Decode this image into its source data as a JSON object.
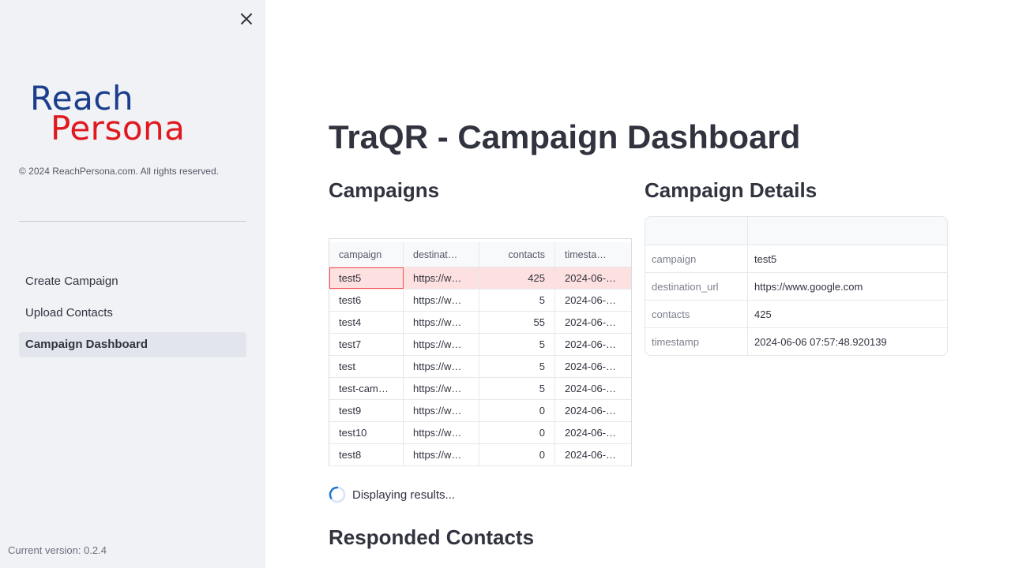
{
  "sidebar": {
    "logo": {
      "line1": "Reach",
      "line2": "Persona"
    },
    "copyright": "© 2024 ReachPersona.com. All rights reserved.",
    "nav": [
      {
        "label": "Create Campaign",
        "active": false
      },
      {
        "label": "Upload Contacts",
        "active": false
      },
      {
        "label": "Campaign Dashboard",
        "active": true
      }
    ],
    "version": "Current version: 0.2.4"
  },
  "main": {
    "title": "TraQR - Campaign Dashboard",
    "campaigns_heading": "Campaigns",
    "details_heading": "Campaign Details",
    "responded_heading": "Responded Contacts",
    "status_text": "Displaying results..."
  },
  "campaigns_table": {
    "columns": [
      "campaign",
      "destinat…",
      "contacts",
      "timesta…"
    ],
    "rows": [
      [
        "test5",
        "https://w…",
        "425",
        "2024-06-0…"
      ],
      [
        "test6",
        "https://w…",
        "5",
        "2024-06-0…"
      ],
      [
        "test4",
        "https://w…",
        "55",
        "2024-06-0…"
      ],
      [
        "test7",
        "https://w…",
        "5",
        "2024-06-0…"
      ],
      [
        "test",
        "https://w…",
        "5",
        "2024-06-0…"
      ],
      [
        "test-camp…",
        "https://w…",
        "5",
        "2024-06-0…"
      ],
      [
        "test9",
        "https://w…",
        "0",
        "2024-06-0…"
      ],
      [
        "test10",
        "https://w…",
        "0",
        "2024-06-0…"
      ],
      [
        "test8",
        "https://w…",
        "0",
        "2024-06-0…"
      ]
    ],
    "selected_row": 0
  },
  "details_table": {
    "rows": [
      {
        "key": "campaign",
        "value": "test5"
      },
      {
        "key": "destination_url",
        "value": "https://www.google.com"
      },
      {
        "key": "contacts",
        "value": "425"
      },
      {
        "key": "timestamp",
        "value": "2024-06-06 07:57:48.920139"
      }
    ]
  },
  "colors": {
    "sidebar_bg": "#f0f2f6",
    "brand_blue": "#1a3e8c",
    "brand_red": "#e0181f",
    "selection": "#fde0e0",
    "focus": "#ff4b4b",
    "spinner": "#1f77d4"
  },
  "icons": {
    "close": "close-icon",
    "spinner": "spinner-icon"
  }
}
